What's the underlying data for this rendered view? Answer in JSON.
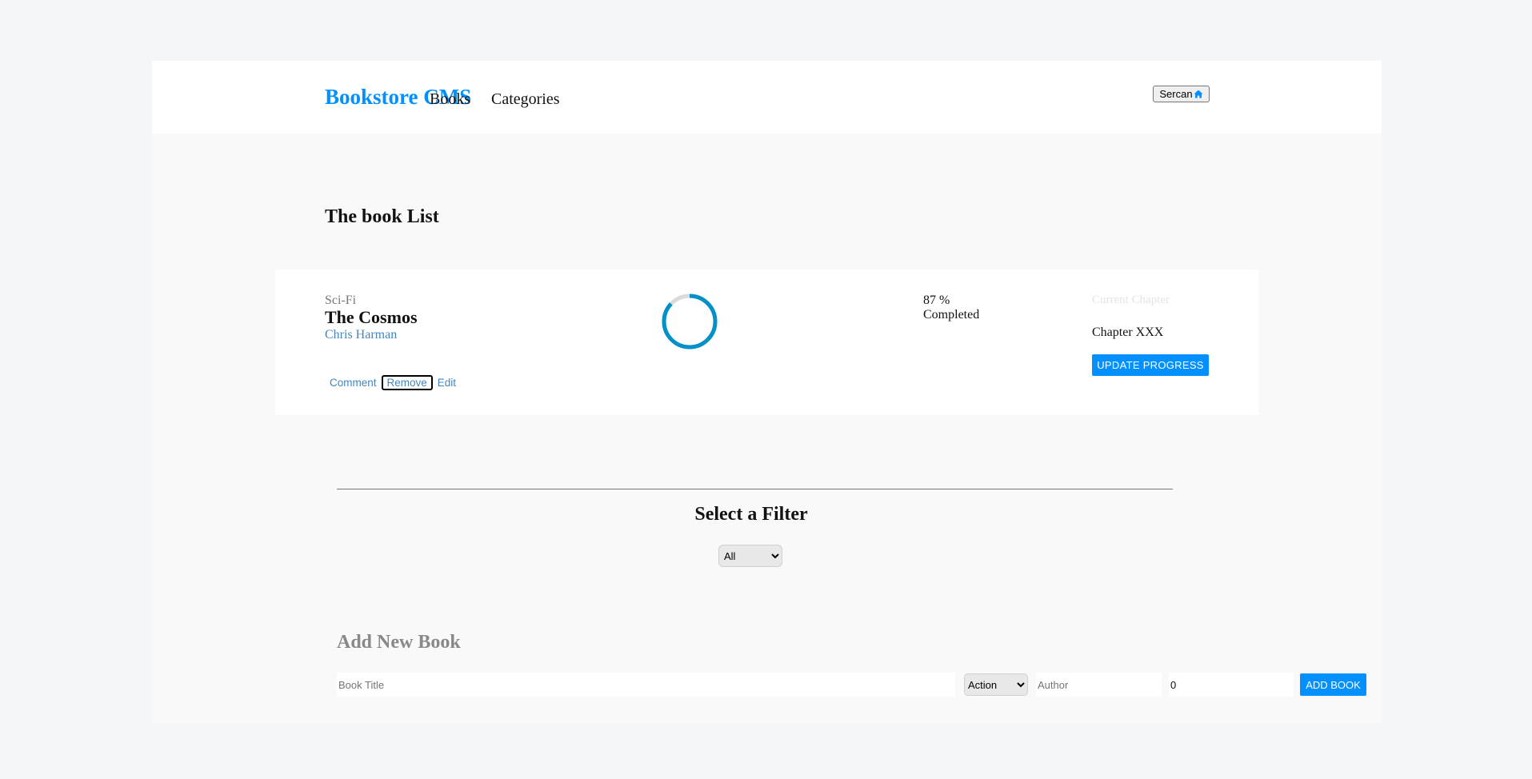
{
  "navbar": {
    "brand": "Bookstore CMS",
    "links": [
      "Books",
      "Categories"
    ],
    "user_button_label": "Sercan",
    "user_button_icon": "home-icon"
  },
  "page_title": "The book List",
  "books": [
    {
      "genre": "Sci-Fi",
      "title": "The Cosmos",
      "author": "Chris Harman",
      "actions": [
        "Comment",
        "Remove",
        "Edit"
      ],
      "progress_fraction": 0.87,
      "percent_text": "87 %",
      "completed_label": "Completed",
      "current_chapter_label": "Current Chapter",
      "current_chapter": "Chapter XXX",
      "update_button": "UPDATE PROGRESS"
    }
  ],
  "filter": {
    "heading": "Select a Filter",
    "selected": "All"
  },
  "add_book": {
    "heading": "Add New Book",
    "title_placeholder": "Book Title",
    "category_selected": "Action",
    "author_placeholder": "Author",
    "progress_value": "0",
    "button": "ADD BOOK"
  },
  "colors": {
    "accent": "#0290ff",
    "author_link": "#4386bf",
    "progress_ring": "#0290c8",
    "progress_track": "#dadada"
  }
}
